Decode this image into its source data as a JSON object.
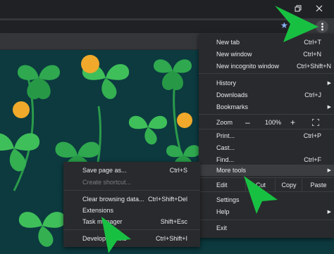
{
  "window": {
    "restore_icon": "restore-window-icon",
    "close_icon": "close-window-icon"
  },
  "toolbar": {
    "bookmark_icon": "star-icon",
    "menu_icon": "vertical-dots-icon"
  },
  "main_menu": {
    "new_tab": {
      "label": "New tab",
      "shortcut": "Ctrl+T"
    },
    "new_window": {
      "label": "New window",
      "shortcut": "Ctrl+N"
    },
    "new_incognito": {
      "label": "New incognito window",
      "shortcut": "Ctrl+Shift+N"
    },
    "history": {
      "label": "History"
    },
    "downloads": {
      "label": "Downloads",
      "shortcut": "Ctrl+J"
    },
    "bookmarks": {
      "label": "Bookmarks"
    },
    "zoom": {
      "label": "Zoom",
      "minus": "–",
      "value": "100%",
      "plus": "+"
    },
    "print": {
      "label": "Print...",
      "shortcut": "Ctrl+P"
    },
    "cast": {
      "label": "Cast..."
    },
    "find": {
      "label": "Find...",
      "shortcut": "Ctrl+F"
    },
    "more_tools": {
      "label": "More tools"
    },
    "edit": {
      "label": "Edit",
      "cut": "Cut",
      "copy": "Copy",
      "paste": "Paste"
    },
    "settings": {
      "label": "Settings"
    },
    "help": {
      "label": "Help"
    },
    "exit": {
      "label": "Exit"
    }
  },
  "sub_menu": {
    "save_page": {
      "label": "Save page as...",
      "shortcut": "Ctrl+S"
    },
    "create_shortcut": {
      "label": "Create shortcut..."
    },
    "clear_data": {
      "label": "Clear browsing data...",
      "shortcut": "Ctrl+Shift+Del"
    },
    "extensions": {
      "label": "Extensions"
    },
    "task_manager": {
      "label": "Task manager",
      "shortcut": "Shift+Esc"
    },
    "developer_tools": {
      "label": "Developer tools",
      "shortcut": "Ctrl+Shift+I"
    }
  },
  "colors": {
    "pointer": "#18c042",
    "menu_bg": "#292a2d",
    "page_bg": "#0c3a3f",
    "clover": "#2fa84f",
    "coin": "#f0a92a"
  }
}
